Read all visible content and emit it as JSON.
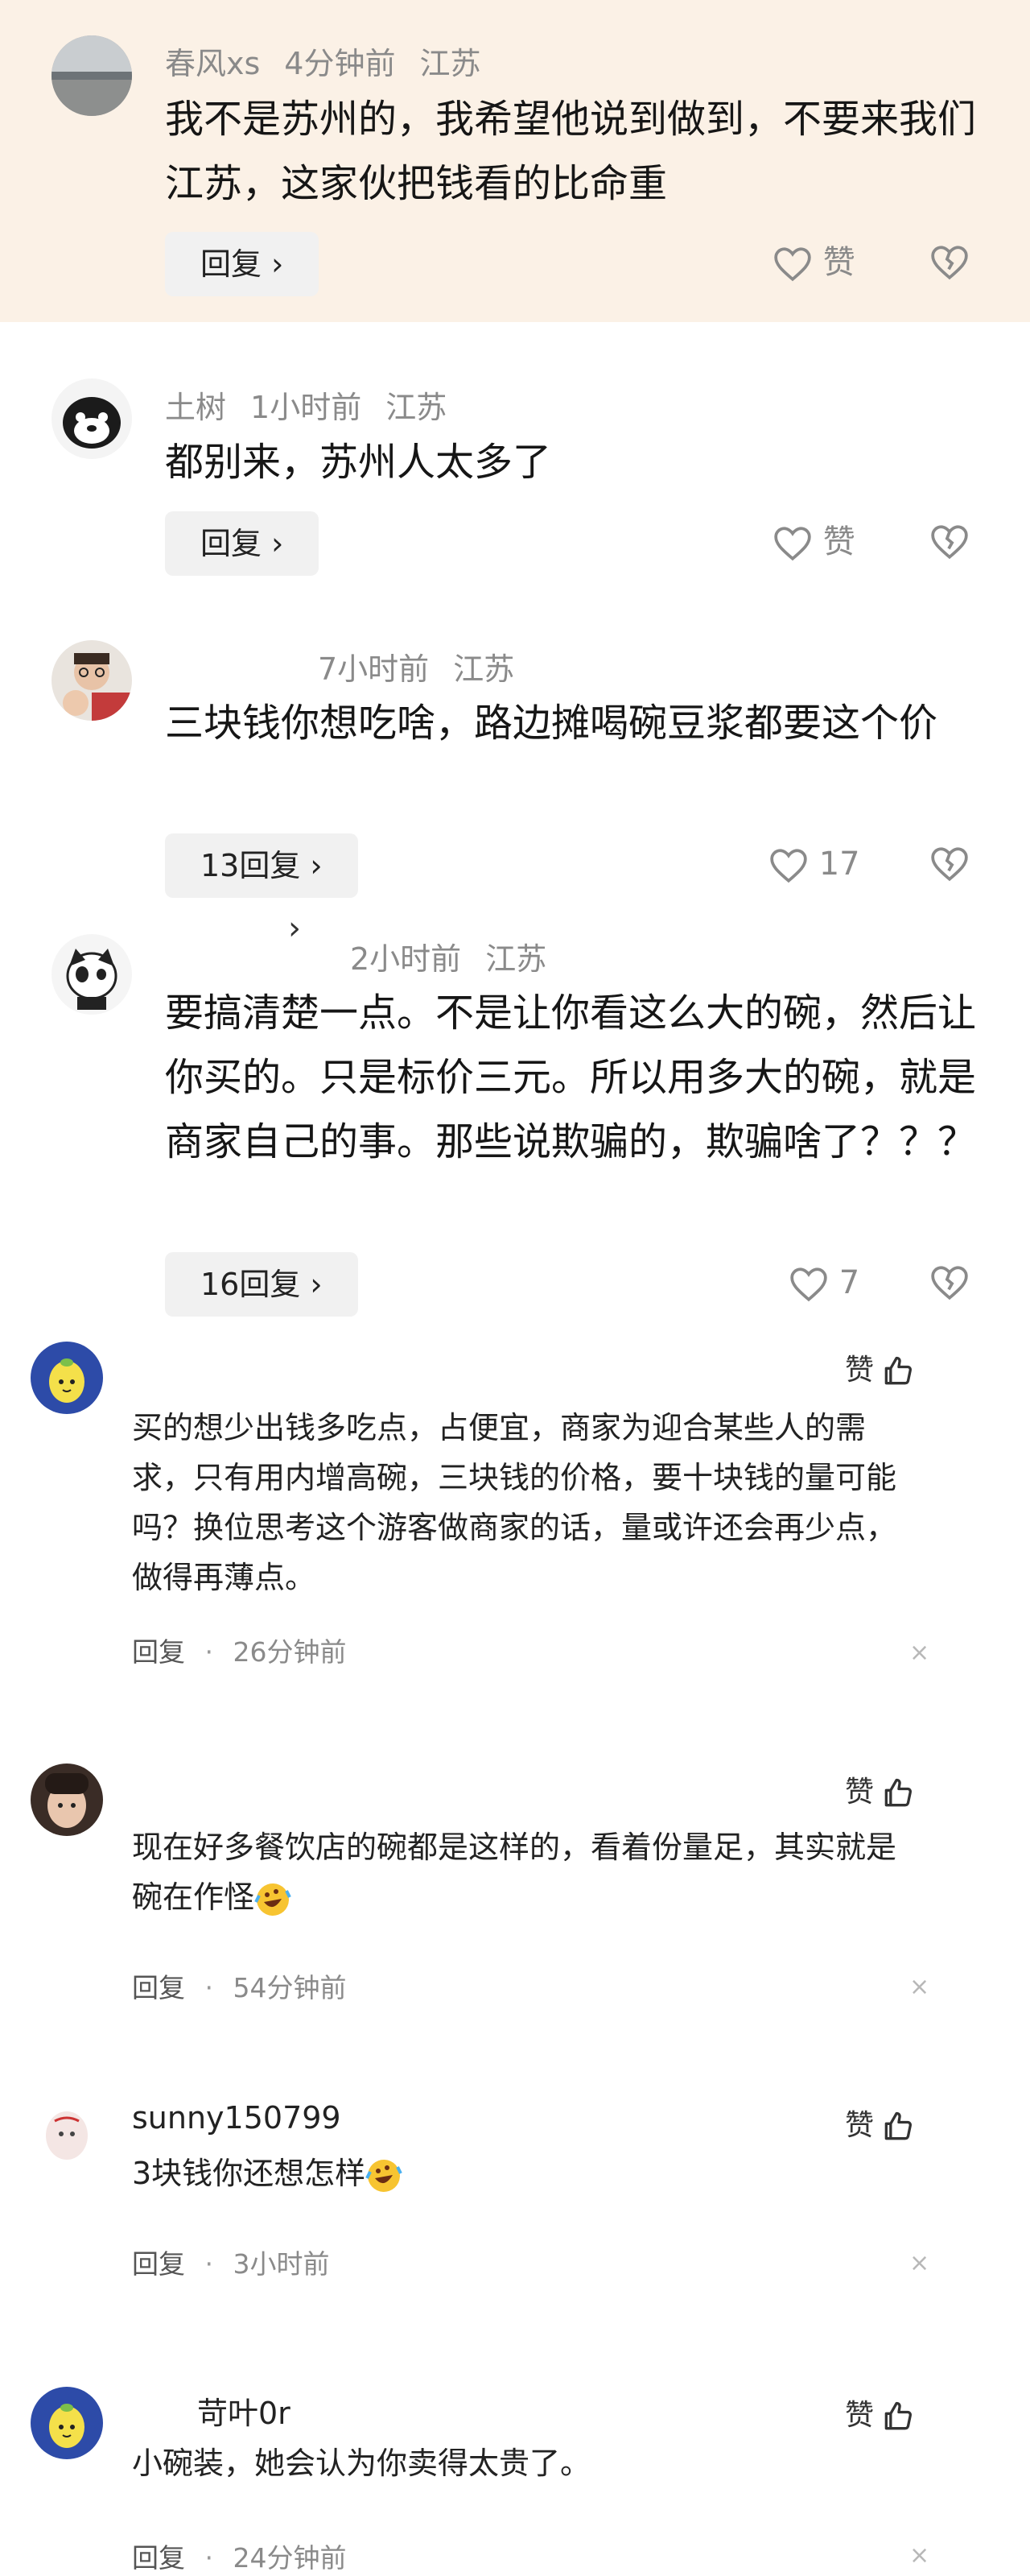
{
  "top_comments": [
    {
      "username": "春风xs",
      "time": "4分钟前",
      "location": "江苏",
      "text": "我不是苏州的，我希望他说到做到，不要来我们江苏，这家伙把钱看的比命重",
      "reply_label": "回复 ›",
      "like_label": "赞",
      "highlight": true
    },
    {
      "username": "土树",
      "time": "1小时前",
      "location": "江苏",
      "text": "都别来，苏州人太多了",
      "reply_label": "回复 ›",
      "like_label": "赞",
      "highlight": false
    },
    {
      "username": "",
      "time": "7小时前",
      "location": "江苏",
      "text": "三块钱你想吃啥，路边摊喝碗豆浆都要这个价",
      "reply_label": "13回复 ›",
      "like_label": "17",
      "highlight": false
    },
    {
      "username": "",
      "time": "2小时前",
      "location": "江苏",
      "text": "要搞清楚一点。不是让你看这么大的碗，然后让你买的。只是标价三元。所以用多大的碗，就是商家自己的事。那些说欺骗的，欺骗啥了？？？",
      "reply_label": "16回复 ›",
      "like_label": "7",
      "highlight": false
    }
  ],
  "stray_chevron": "›",
  "bottom_comments": [
    {
      "username": "",
      "like_label": "赞",
      "text": "买的想少出钱多吃点，占便宜，商家为迎合某些人的需求，只有用内增高碗，三块钱的价格，要十块钱的量可能吗？换位思考这个游客做商家的话，量或许还会再少点，做得再薄点。",
      "reply_label": "回复",
      "time": "26分钟前",
      "close": "×"
    },
    {
      "username": "",
      "like_label": "赞",
      "text": "现在好多餐饮店的碗都是这样的，看着份量足，其实就是碗在作怪",
      "reply_label": "回复",
      "time": "54分钟前",
      "close": "×"
    },
    {
      "username": "sunny150799",
      "like_label": "赞",
      "text": "3块钱你还想怎样",
      "reply_label": "回复",
      "time": "3小时前",
      "close": "×"
    },
    {
      "username": "苛叶0r",
      "like_label": "赞",
      "text": "小碗装，她会认为你卖得太贵了。",
      "reply_label": "回复",
      "time": "24分钟前",
      "close": "×"
    }
  ],
  "separator": "·",
  "colors": {
    "highlight_bg": "#fbf1e6",
    "meta_gray": "#8a8a8a",
    "reply_bg": "#f1f1f1",
    "text": "#161616"
  },
  "icons": [
    "heart-icon",
    "broken-heart-icon",
    "thumbs-up-icon",
    "close-icon",
    "chevron-right-icon",
    "laughing-crying-emoji"
  ]
}
